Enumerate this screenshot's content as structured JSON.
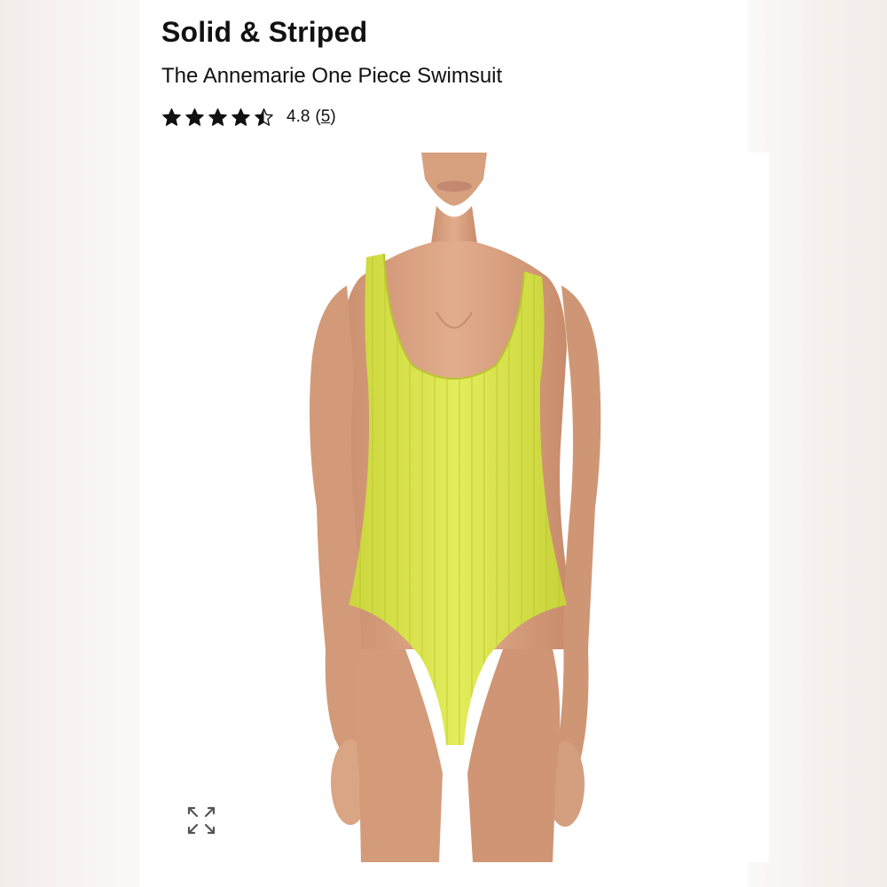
{
  "product": {
    "brand": "Solid & Striped",
    "name": "The Annemarie One Piece Swimsuit",
    "rating": {
      "value": "4.8",
      "review_count": "5",
      "stars_score": 4.5,
      "stars_max": 5
    }
  },
  "image": {
    "expand_icon": "expand-arrows-icon",
    "swimsuit_color": "#dde84f"
  },
  "colors": {
    "text": "#111111",
    "star": "#111111"
  }
}
